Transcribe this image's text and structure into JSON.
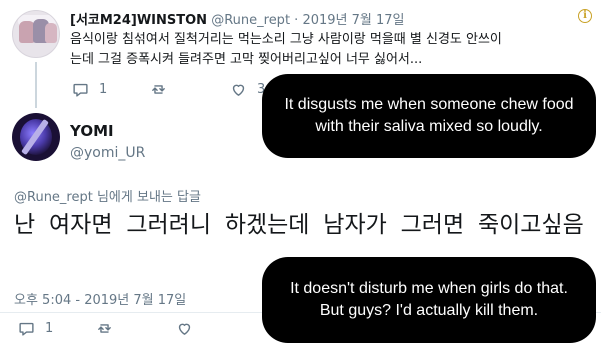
{
  "parent_tweet": {
    "display_name": "[서코M24]WINSTON",
    "handle": "@Rune_rept",
    "date": " · 2019년 7월 17일",
    "text_line1": "음식이랑 침섞여서 질척거리는 먹는소리 그냥 사람이랑 먹을때 별 신경도 안쓰이",
    "text_line2": "는데 그걸 증폭시켜 들려주면 고막 찢어버리고싶어 너무 싫어서...",
    "reply_count": "1",
    "like_count": "3"
  },
  "main_tweet": {
    "display_name": "YOMI",
    "handle": "@yomi_UR",
    "reply_to_handle": "@Rune_rept",
    "reply_to_suffix": " 님에게 보내는 답글",
    "text": "난 여자면 그러려니 하겠는데 남자가 그러면 죽이고싶음",
    "timestamp": "오후 5:04 - 2019년 7월 17일",
    "reply_count": "1"
  },
  "captions": {
    "first": "It disgusts me when someone chew food with their saliva mixed so loudly.",
    "second": "It doesn't disturb me when girls do that. But guys? I'd actually kill them."
  },
  "icons": {
    "info": "info-icon",
    "reply": "reply-icon",
    "retweet": "retweet-icon",
    "like": "heart-icon"
  },
  "colors": {
    "text_primary": "#14171a",
    "text_secondary": "#657786",
    "caption_bg": "#000000",
    "caption_text": "#ffffff"
  }
}
